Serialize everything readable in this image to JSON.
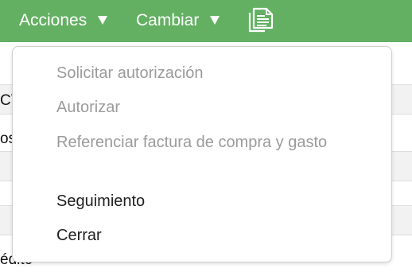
{
  "toolbar": {
    "acciones_label": "Acciones",
    "cambiar_label": "Cambiar",
    "document_icon": "documents-icon",
    "background_color": "#63b063"
  },
  "background_page": {
    "row1_text": "CT",
    "row2_text": "os",
    "row3_text": "édito"
  },
  "menu": {
    "items": [
      {
        "label": "Solicitar autorización",
        "enabled": false
      },
      {
        "label": "Autorizar",
        "enabled": false
      },
      {
        "label": "Referenciar factura de compra y gasto",
        "enabled": false
      },
      {
        "label": "Seguimiento",
        "enabled": true
      },
      {
        "label": "Cerrar",
        "enabled": true
      }
    ],
    "disabled_color": "#9b9b9b",
    "enabled_color": "#1f1f1f"
  }
}
